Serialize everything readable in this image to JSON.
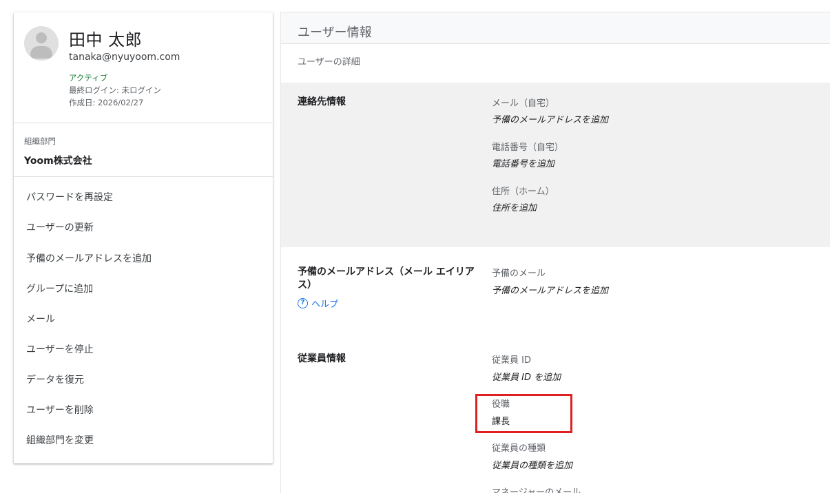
{
  "user": {
    "name": "田中 太郎",
    "email": "tanaka@nyuyoom.com",
    "status": "アクティブ",
    "last_login": "最終ログイン: 未ログイン",
    "created": "作成日: 2026/02/27"
  },
  "org": {
    "label": "組織部門",
    "value": "Yoom株式会社"
  },
  "actions": [
    {
      "label": "パスワードを再設定"
    },
    {
      "label": "ユーザーの更新"
    },
    {
      "label": "予備のメールアドレスを追加"
    },
    {
      "label": "グループに追加"
    },
    {
      "label": "メール"
    },
    {
      "label": "ユーザーを停止"
    },
    {
      "label": "データを復元"
    },
    {
      "label": "ユーザーを削除"
    },
    {
      "label": "組織部門を変更"
    }
  ],
  "panel": {
    "title": "ユーザー情報",
    "subtitle": "ユーザーの詳細"
  },
  "contact": {
    "title": "連絡先情報",
    "email_label": "メール（自宅）",
    "email_value": "予備のメールアドレスを追加",
    "phone_label": "電話番号（自宅）",
    "phone_value": "電話番号を追加",
    "address_label": "住所（ホーム）",
    "address_value": "住所を追加"
  },
  "alias": {
    "title_line1": "予備のメールアドレス（メール エイリア",
    "title_line2": "ス）",
    "help": "ヘルプ",
    "help_icon": "?",
    "label": "予備のメール",
    "value": "予備のメールアドレスを追加"
  },
  "employee": {
    "title": "従業員情報",
    "id_label": "従業員 ID",
    "id_value": "従業員 ID を追加",
    "role_label": "役職",
    "role_value": "課長",
    "type_label": "従業員の種類",
    "type_value": "従業員の種類を追加",
    "manager_label": "マネージャーのメール"
  }
}
